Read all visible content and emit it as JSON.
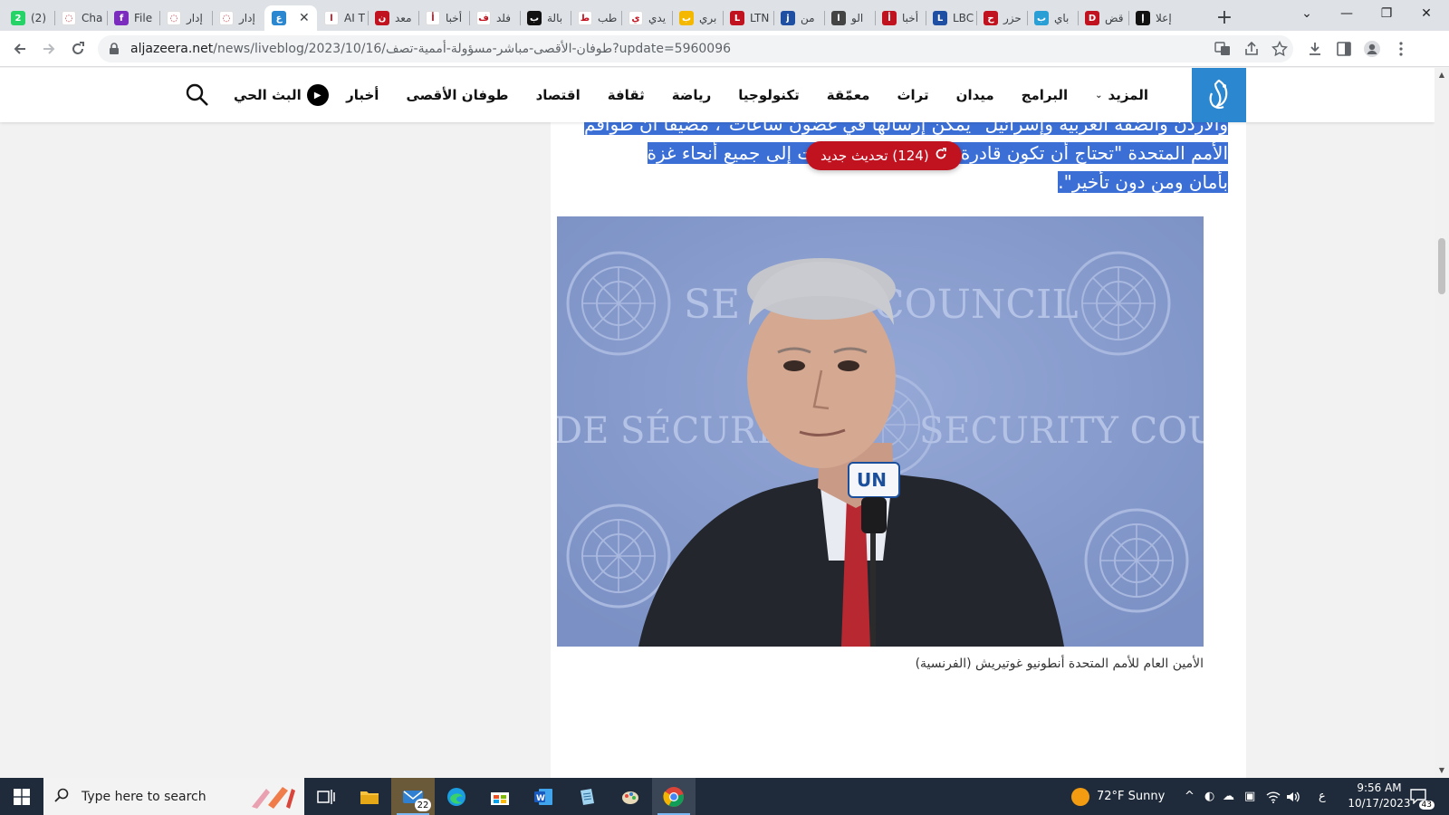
{
  "browser": {
    "tabs": [
      {
        "label": "(2)",
        "favicon": "whatsapp-icon",
        "color": "#25d366",
        "glyph": "2"
      },
      {
        "label": "Cha",
        "favicon": "chat-icon",
        "color": "#ffffff",
        "glyph": "◌"
      },
      {
        "label": "File",
        "favicon": "file-icon",
        "color": "#7b2cbf",
        "glyph": "f"
      },
      {
        "label": "إدار",
        "favicon": "loading-icon",
        "color": "#ffffff",
        "glyph": "◌"
      },
      {
        "label": "إدار",
        "favicon": "loading-icon",
        "color": "#ffffff",
        "glyph": "◌"
      },
      {
        "label": "",
        "favicon": "aljazeera-icon",
        "color": "#2a87d0",
        "glyph": "ع",
        "active": true,
        "close": "✕"
      },
      {
        "label": "AI T",
        "favicon": "news-icon",
        "color": "#ffffff",
        "glyph": "ا"
      },
      {
        "label": "معد",
        "favicon": "news-icon",
        "color": "#c1121f",
        "glyph": "ن"
      },
      {
        "label": "أخبا",
        "favicon": "news-icon",
        "color": "#ffffff",
        "glyph": "أ"
      },
      {
        "label": "فلد",
        "favicon": "news-icon",
        "color": "#ffffff",
        "glyph": "ف"
      },
      {
        "label": "بالة",
        "favicon": "news-icon",
        "color": "#111111",
        "glyph": "ب"
      },
      {
        "label": "طب",
        "favicon": "news-icon",
        "color": "#ffffff",
        "glyph": "ط"
      },
      {
        "label": "يدي",
        "favicon": "news-icon",
        "color": "#ffffff",
        "glyph": "ي"
      },
      {
        "label": "بري",
        "favicon": "news-icon",
        "color": "#f5b800",
        "glyph": "ب"
      },
      {
        "label": "LTN",
        "favicon": "news-icon",
        "color": "#c1121f",
        "glyph": "L"
      },
      {
        "label": "من",
        "favicon": "news-icon",
        "color": "#1e4fa3",
        "glyph": "j"
      },
      {
        "label": "الو",
        "favicon": "news-icon",
        "color": "#444444",
        "glyph": "ا"
      },
      {
        "label": "أخبا",
        "favicon": "news-icon",
        "color": "#c1121f",
        "glyph": "أ"
      },
      {
        "label": "LBC",
        "favicon": "news-icon",
        "color": "#1e4fa3",
        "glyph": "L"
      },
      {
        "label": "حزر",
        "favicon": "news-icon",
        "color": "#c1121f",
        "glyph": "ح"
      },
      {
        "label": "باي",
        "favicon": "news-icon",
        "color": "#2a9fd6",
        "glyph": "ب"
      },
      {
        "label": "قض",
        "favicon": "news-icon",
        "color": "#c1121f",
        "glyph": "D"
      },
      {
        "label": "إعلا",
        "favicon": "news-icon",
        "color": "#111111",
        "glyph": "إ"
      }
    ],
    "new_tab": "+",
    "window_controls": [
      "⌄",
      "—",
      "❐",
      "✕"
    ],
    "url_host": "aljazeera.net",
    "url_rest": "/news/liveblog/2023/10/16/طوفان-الأقصى-مباشر-مسؤولة-أممية-تصف?update=5960096"
  },
  "site": {
    "nav": [
      "أخبار",
      "طوفان الأقصى",
      "اقتصاد",
      "ثقافة",
      "رياضة",
      "تكنولوجيا",
      "معمّقة",
      "تراث",
      "ميدان",
      "البرامج"
    ],
    "more": "المزيد",
    "live": "البث الحي",
    "brand_color": "#2a87d0"
  },
  "article": {
    "lines": [
      "والأردن والضفة الغربية وإسرائيل \"يمكن إرسالها في غضون ساعات\"، مضيفًا أن طواقم",
      "الأمم المتحدة \"تحتاج أن تكون قادرة على إيصال الإمدادات إلى جميع أنحاء غزة",
      "بأمان ومن دون تأخير\"."
    ],
    "update_pill": "(124) تحديث جديد",
    "photo_texts": {
      "council": "COUNCIL",
      "security_council": "SECURITY COU",
      "securite": "DE SÉCURIT",
      "se": "SE",
      "mic": "UN"
    },
    "caption": "الأمين العام للأمم المتحدة أنطونيو غوتيريش (الفرنسية)",
    "highlight_color": "#3b6fd6",
    "pill_color": "#c1121f"
  },
  "taskbar": {
    "search_placeholder": "Type here to search",
    "mail_badge": "22",
    "weather": "72°F  Sunny",
    "lang": "ع",
    "time": "9:56 AM",
    "date": "10/17/2023",
    "notifications": "43"
  }
}
